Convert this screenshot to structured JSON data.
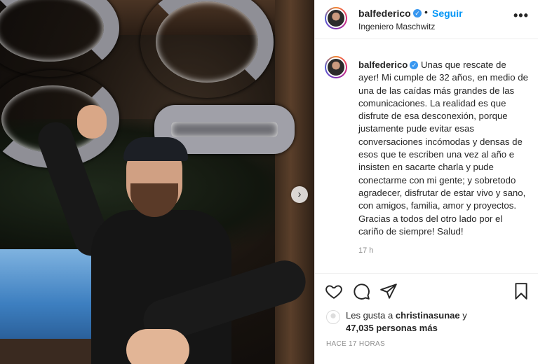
{
  "post": {
    "username": "balfederico",
    "location": "Ingeniero Maschwitz",
    "follow_label": "Seguir",
    "separator": "•",
    "more_label": "•••",
    "caption": "Unas que rescate de ayer! Mi cumple de 32 años, en medio de una de las caídas más grandes de las comunicaciones. La realidad es que disfrute de esa desconexión, porque justamente pude evitar esas conversaciones incómodas y densas de esos que te escriben una vez al año e insisten en sacarte charla y pude conectarme con mi gente; y sobretodo agradecer, disfrutar de estar vivo y sano, con amigos, familia, amor y proyectos. Gracias a todos del otro lado por el cariño de siempre! Salud!",
    "comment_time": "17 h",
    "carousel_next": "›"
  },
  "likes": {
    "prefix": "Les gusta a",
    "liker": "christinasunae",
    "conjunction": "y",
    "count": "47,035 personas más"
  },
  "timestamp": "HACE 17 HORAS",
  "icons": [
    "heart-icon",
    "comment-icon",
    "share-icon",
    "bookmark-icon",
    "verified-icon",
    "chevron-right-icon"
  ],
  "colors": {
    "link": "#0095f6",
    "verified": "#3897f0",
    "muted": "#8e8e8e",
    "text": "#262626"
  }
}
